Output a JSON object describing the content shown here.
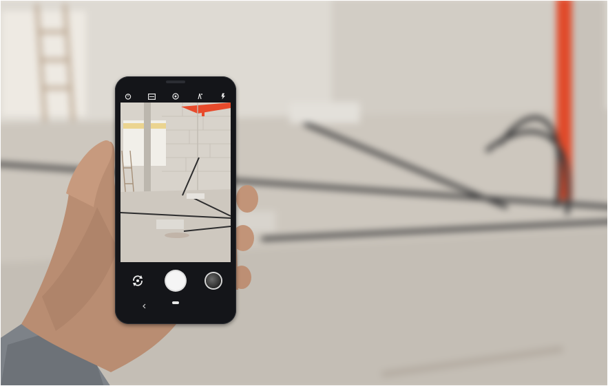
{
  "scene": {
    "description_tags": [
      "construction-site",
      "hand-holding-phone",
      "camera-app"
    ]
  },
  "camera_app": {
    "top_icons": [
      "timer-icon",
      "aspect-ratio-icon",
      "filter-icon",
      "hdr-icon",
      "flash-icon"
    ],
    "bottom_controls": [
      "switch-camera-icon",
      "shutter-button",
      "gallery-thumbnail"
    ],
    "nav_icons": [
      "back-icon",
      "home-pill"
    ]
  },
  "colors": {
    "wall": "#d9d4cc",
    "floor": "#c9c3ba",
    "pipe_red": "#e84a2b",
    "phone_body": "#141519",
    "skin": "#b98d72",
    "sleeve": "#7d8288"
  }
}
